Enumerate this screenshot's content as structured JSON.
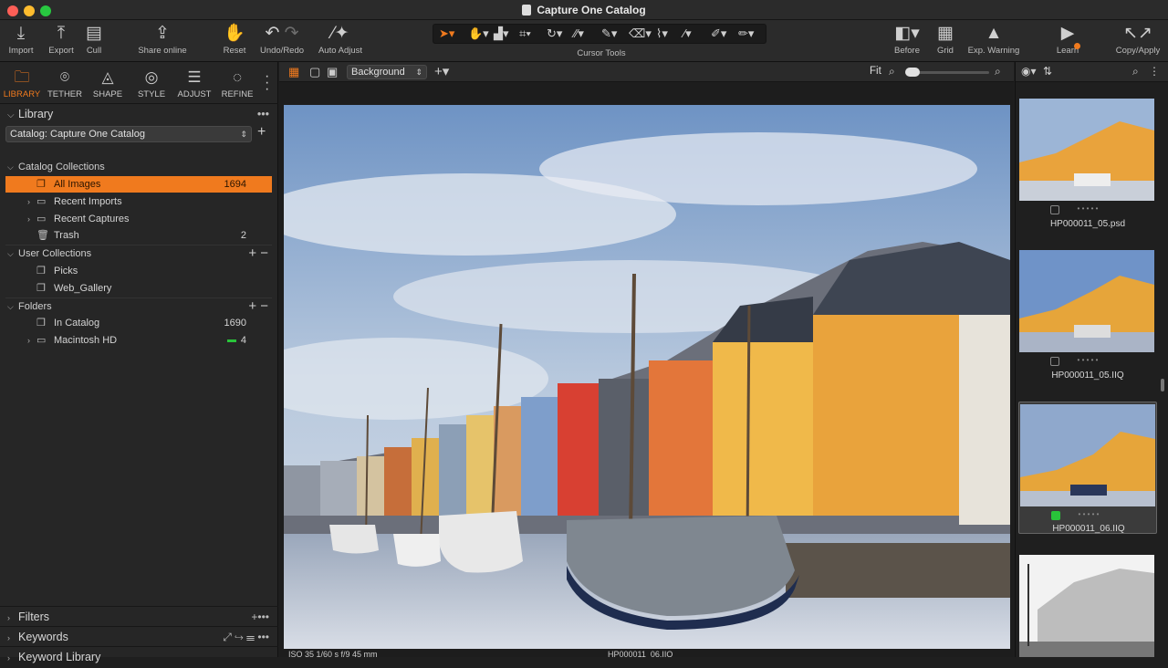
{
  "window": {
    "title": "Capture One Catalog"
  },
  "toolbar": {
    "import": "Import",
    "export": "Export",
    "cull": "Cull",
    "share_online": "Share online",
    "reset": "Reset",
    "undo_redo": "Undo/Redo",
    "auto_adjust": "Auto Adjust",
    "cursor_tools": "Cursor Tools",
    "before": "Before",
    "grid": "Grid",
    "exp_warning": "Exp. Warning",
    "learn": "Learn",
    "copy_apply": "Copy/Apply"
  },
  "tabs": [
    {
      "label": "LIBRARY",
      "icon": "folder-icon",
      "active": true
    },
    {
      "label": "TETHER",
      "icon": "camera-icon"
    },
    {
      "label": "SHAPE",
      "icon": "shape-icon"
    },
    {
      "label": "STYLE",
      "icon": "style-icon"
    },
    {
      "label": "ADJUST",
      "icon": "sliders-icon"
    },
    {
      "label": "REFINE",
      "icon": "refine-icon"
    }
  ],
  "library": {
    "title": "Library",
    "catalog_select": "Catalog: Capture One Catalog",
    "catalog_collections": "Catalog Collections",
    "all_images": {
      "label": "All Images",
      "count": "1694"
    },
    "recent_imports": "Recent Imports",
    "recent_captures": "Recent Captures",
    "trash": {
      "label": "Trash",
      "count": "2"
    },
    "user_collections": "User Collections",
    "picks": "Picks",
    "web_gallery": "Web_Gallery",
    "folders": "Folders",
    "in_catalog": {
      "label": "In Catalog",
      "count": "1690"
    },
    "macintosh_hd": {
      "label": "Macintosh HD",
      "count": "4"
    }
  },
  "bottom_sections": {
    "filters": "Filters",
    "keywords": "Keywords",
    "keyword_library": "Keyword Library"
  },
  "viewer": {
    "layer_select": "Background",
    "fit": "Fit",
    "zoom_level": 0.0,
    "status_left": "ISO 35    1/60 s    f/9    45 mm",
    "status_center": "HP000011_06.IIQ"
  },
  "browser": {
    "thumbs": [
      {
        "name": "HP000011_05.psd",
        "selected": false,
        "color_tag": false
      },
      {
        "name": "HP000011_05.IIQ",
        "selected": false,
        "color_tag": false
      },
      {
        "name": "HP000011_06.IIQ",
        "selected": true,
        "color_tag": true
      }
    ],
    "rating_dots": "• • • • •"
  },
  "colors": {
    "accent": "#f07a1e",
    "green_tag": "#29c43a",
    "panel": "#262626"
  }
}
